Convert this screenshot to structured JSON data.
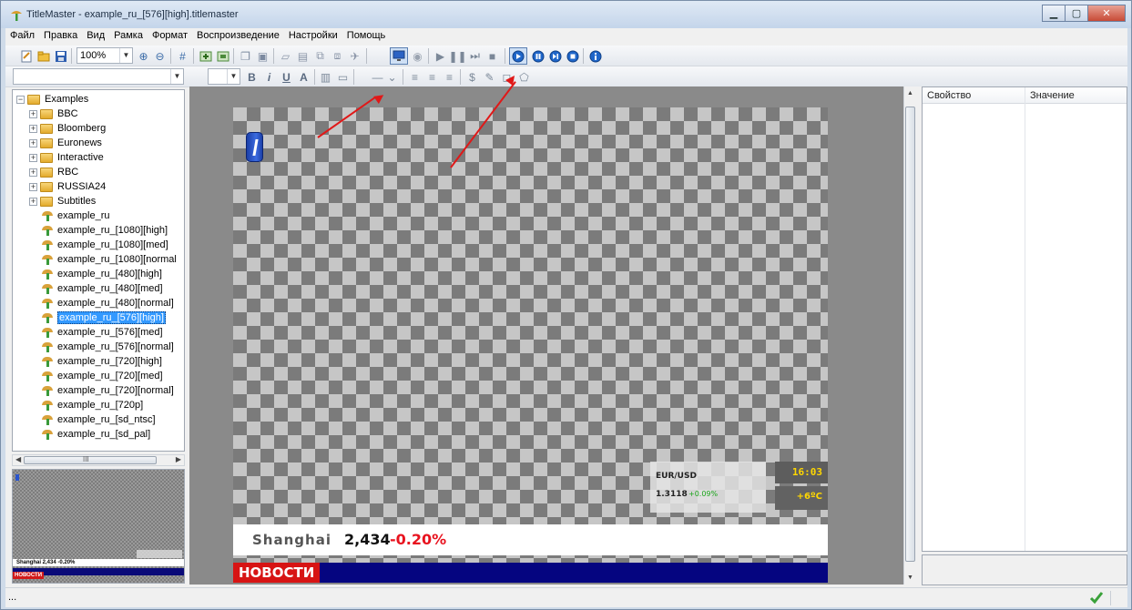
{
  "window": {
    "title": "TitleMaster - example_ru_[576][high].titlemaster",
    "controls": [
      "minimize",
      "maximize",
      "close"
    ]
  },
  "menu": [
    "Файл",
    "Правка",
    "Вид",
    "Рамка",
    "Формат",
    "Воспроизведение",
    "Настройки",
    "Помощь"
  ],
  "toolbar": {
    "zoom": "100%",
    "icons": [
      "new-icon",
      "open-icon",
      "save-icon",
      "zoom-in-icon",
      "zoom-out-icon",
      "grid-icon",
      "add-layer-icon",
      "layer-icon",
      "copy-icon",
      "paste-icon",
      "frame-icon",
      "duplicate-icon",
      "group-icon",
      "ungroup-icon",
      "pin-icon",
      "monitor-icon",
      "eye-icon",
      "play-icon",
      "pause-icon",
      "step-icon",
      "stop-icon",
      "live-play-icon",
      "live-pause-icon",
      "live-step-icon",
      "live-stop-icon",
      "info-icon"
    ],
    "format_buttons": [
      "B",
      "i",
      "U",
      "A"
    ]
  },
  "tree": {
    "root": "Examples",
    "folders": [
      "BBC",
      "Bloomberg",
      "Euronews",
      "Interactive",
      "RBC",
      "RUSSIA24",
      "Subtitles"
    ],
    "items": [
      "example_ru",
      "example_ru_[1080][high]",
      "example_ru_[1080][med]",
      "example_ru_[1080][normal",
      "example_ru_[480][high]",
      "example_ru_[480][med]",
      "example_ru_[480][normal]",
      "example_ru_[576][high]",
      "example_ru_[576][med]",
      "example_ru_[576][normal]",
      "example_ru_[720][high]",
      "example_ru_[720][med]",
      "example_ru_[720][normal]",
      "example_ru_[720p]",
      "example_ru_[sd_ntsc]",
      "example_ru_[sd_pal]"
    ],
    "selected": "example_ru_[576][high]",
    "hscroll_label": "III"
  },
  "preview": {
    "ticker": "Shanghai 2,434 -0.20%",
    "news": "НОВОСТИ"
  },
  "canvas": {
    "fx_pair": "EUR/USD",
    "fx_rate": "1.3118",
    "fx_change": "+0.09%",
    "time": "16:03",
    "temperature": "+6ºC",
    "ticker_name": "Shanghai",
    "ticker_value": "2,434",
    "ticker_change": "-0.20%",
    "news_label": "НОВОСТИ"
  },
  "properties": {
    "col_property": "Свойство",
    "col_value": "Значение"
  },
  "status": {
    "text": "...",
    "ok_icon": "check-icon"
  },
  "colors": {
    "accent_red": "#e8131f",
    "news_blue": "#050580",
    "selection": "#3399ff",
    "time_yellow": "#ffd700",
    "positive_green": "#1aa51a"
  }
}
